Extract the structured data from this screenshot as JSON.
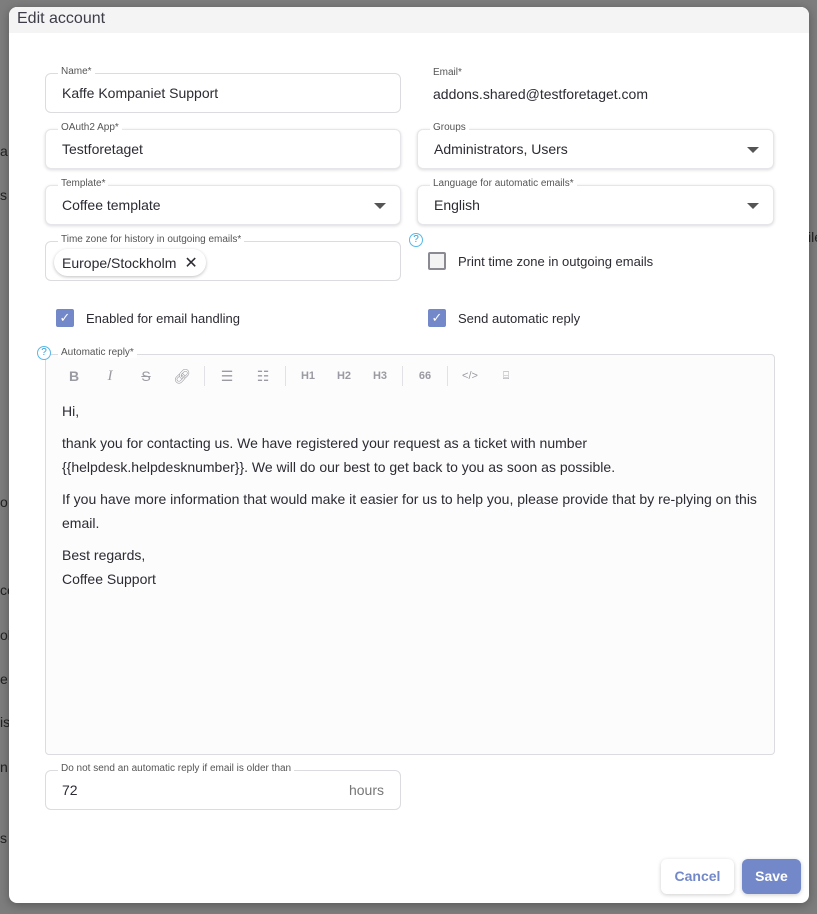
{
  "background": {
    "fragments": [
      "a",
      "s",
      "o",
      "ce",
      "ola",
      "e",
      "is",
      "n",
      "s",
      "ile"
    ]
  },
  "dialog": {
    "title": "Edit account"
  },
  "form": {
    "name": {
      "label": "Name*",
      "value": "Kaffe Kompaniet Support"
    },
    "email": {
      "label": "Email*",
      "value": "addons.shared@testforetaget.com"
    },
    "oauth": {
      "label": "OAuth2 App*",
      "value": "Testforetaget"
    },
    "groups": {
      "label": "Groups",
      "value": "Administrators, Users"
    },
    "template": {
      "label": "Template*",
      "value": "Coffee template"
    },
    "language": {
      "label": "Language for automatic emails*",
      "value": "English"
    },
    "timezone": {
      "label": "Time zone for history in outgoing emails*",
      "chip": "Europe/Stockholm"
    },
    "print_tz": {
      "label": "Print time zone in outgoing emails",
      "checked": false
    },
    "enabled": {
      "label": "Enabled for email handling",
      "checked": true
    },
    "send_reply": {
      "label": "Send automatic reply",
      "checked": true
    },
    "reply": {
      "label": "Automatic reply*",
      "toolbar": [
        "B",
        "I",
        "S",
        "link",
        "bullet-list",
        "numbered-list",
        "H1",
        "H2",
        "H3",
        "66",
        "</>",
        "code-block"
      ],
      "paragraphs": [
        "Hi,",
        "thank you for contacting us. We have registered your request as a ticket with number {{helpdesk.helpdesknumber}}. We will do our best to get back to you as soon as possible.",
        "If you have more information that would make it easier for us to help you, please provide that by re-plying on this email."
      ],
      "signoff": [
        "Best regards,",
        "Coffee Support"
      ]
    },
    "max_age": {
      "label": "Do not send an automatic reply if email is older than",
      "value": "72",
      "unit": "hours"
    }
  },
  "help": "?",
  "buttons": {
    "cancel": "Cancel",
    "save": "Save"
  },
  "colors": {
    "accent": "#7388c8",
    "help": "#2aa0dd"
  }
}
